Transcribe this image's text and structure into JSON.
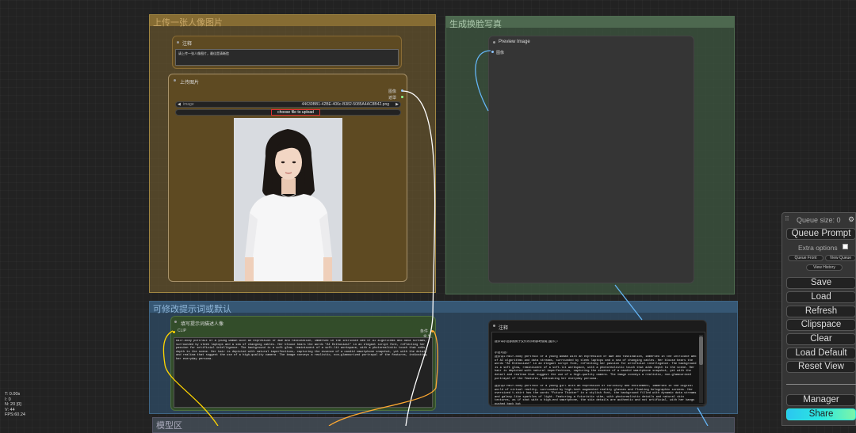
{
  "groups": {
    "upload": "上传一张人像图片",
    "generate": "生成换脸写真",
    "modify": "可修改提示词或默认",
    "output": "模型区"
  },
  "nodes": {
    "note_top": {
      "title": "注释",
      "text": "请上传一张人像图片，最佳是清晰脸"
    },
    "load_image": {
      "title": "上传图片",
      "output_image": "图像",
      "output_mask": "遮罩",
      "widget_label": "image",
      "widget_value": "44630BB1-42BE-406c-B382-5085A4AC8B42.png",
      "upload_button": "choose file to upload"
    },
    "preview": {
      "title": "Preview Image",
      "input_label": "图像"
    },
    "prompt": {
      "title": "填写提示词描述人像",
      "input_label": "CLIP",
      "output_label": "条件",
      "text": "Half-body portrait of a young woman with an expression of awe and fascination, immersed in the intricate web of AI algorithms and data streams, surrounded by sleek laptops and a sea of changing cables. Her blouse bears the words \"AI Enthusiast\" in an elegant script font, reflecting her passion for artificial intelligence. The background is a soft glow, reminiscent of a soft-lit workspace, with a photorealistic touch that adds depth to the scene. Her hair is depicted with natural imperfections, capturing the essence of a candid smartphone snapshot, yet with the detail and realism that suggest the use of a high-quality camera. The image conveys a realistic, non-glamourized portrayal of the features, indicating her everyday persona."
    },
    "note_bottom": {
      "title": "注释",
      "intro": "提示词示范参照例子仅作为示例参考使用(图示):",
      "heading1": "示范可选:",
      "example1": "提示词1:Half-body portrait of a young woman with an expression of awe and fascination, immersed in the intricate web of AI algorithms and data streams, surrounded by sleek laptops and a sea of changing cables. Her blouse bears the words \"AI Enthusiast\" in an elegant script font, reflecting her passion for artificial intelligence. The background is a soft glow, reminiscent of a soft-lit workspace, with a photorealistic touch that adds depth to the scene. Her hair is depicted with natural imperfections, capturing the essence of a candid smartphone snapshot, yet with the detail and realism that suggest the use of a high-quality camera. The image conveys a realistic, non-glamourized portrayal of the features, indicating her everyday persona.",
      "example2": "提示词2:Half-body portrait of a young girl with an expression of curiosity and excitement, immersed in the digital world of virtual reality, surrounded by high-tech augmented reality glasses and floating holographic screens. Her oversized t-shirt has the words \"Future Thinker\" in a stylish font, the background filled with dynamic data streams and galaxy-like sparkles of light. Featuring a futuristic vibe, with photorealistic details and natural skin textures, as if shot with a high-end smartphone, the skin details are authentic and not artificial, with her bangs pushed back but"
    }
  },
  "queue_panel": {
    "queue_size": "Queue size: 0",
    "queue_prompt": "Queue Prompt",
    "extra_options": "Extra options",
    "queue_front": "Queue Front",
    "view_queue": "View Queue",
    "view_history": "View History",
    "save": "Save",
    "load": "Load",
    "refresh": "Refresh",
    "clipspace": "Clipspace",
    "clear": "Clear",
    "load_default": "Load Default",
    "reset_view": "Reset View",
    "manager": "Manager",
    "share": "Share"
  },
  "stats": {
    "t": "T: 0.00s",
    "i": "I: 0",
    "n": "N: 20 [0]",
    "v": "V: 44",
    "fps": "FPS:60.24"
  },
  "colors": {
    "group_upload": "#7a6330",
    "group_generate": "#3e5740",
    "group_modify": "#2e4a63",
    "node_prompt": "#334d2a",
    "link_image": "#64b5f6",
    "link_clip": "#ffd500",
    "link_white": "#ffffff",
    "share_button": "#2be7e0"
  }
}
